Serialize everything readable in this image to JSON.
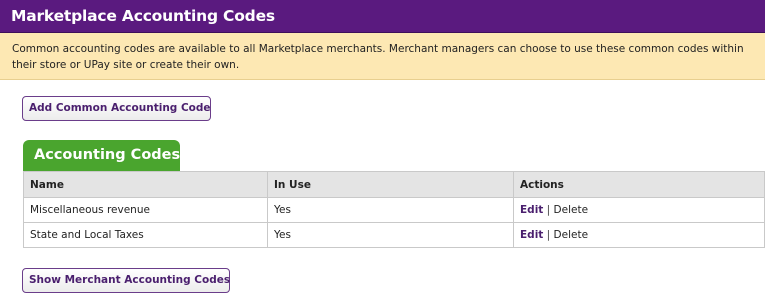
{
  "header": {
    "title": "Marketplace Accounting Codes"
  },
  "notice": {
    "text": "Common accounting codes are available to all Marketplace merchants. Merchant managers can choose to use these common codes within their store or UPay site or create their own."
  },
  "buttons": {
    "add_common": "Add Common Accounting Code",
    "show_merchant": "Show Merchant Accounting Codes"
  },
  "tab": {
    "label": "Accounting Codes"
  },
  "table": {
    "columns": [
      "Name",
      "In Use",
      "Actions"
    ],
    "rows": [
      {
        "name": "Miscellaneous revenue",
        "in_use": "Yes",
        "edit": "Edit",
        "sep": "|",
        "delete": "Delete"
      },
      {
        "name": "State and Local Taxes",
        "in_use": "Yes",
        "edit": "Edit",
        "sep": "|",
        "delete": "Delete"
      }
    ]
  },
  "colors": {
    "header_bg": "#5a1a7f",
    "notice_bg": "#fde8b3",
    "tab_bg": "#4aa52e",
    "link": "#4a1f6e"
  }
}
